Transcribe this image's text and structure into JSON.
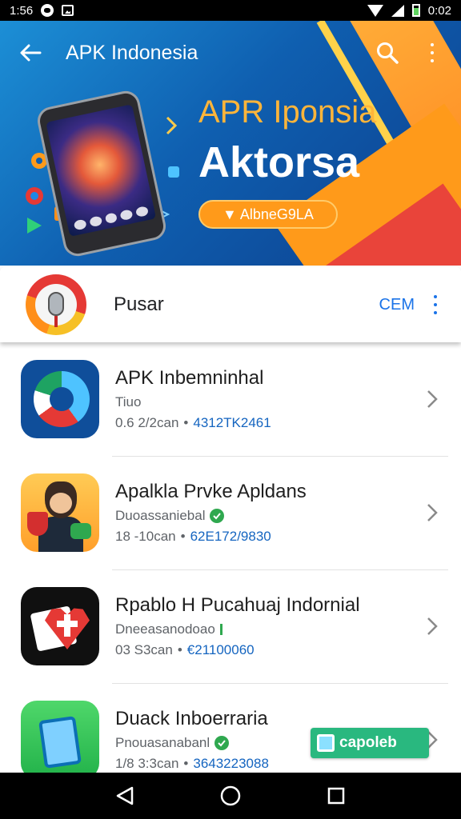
{
  "status_bar": {
    "time_left": "1:56",
    "time_right": "0:02"
  },
  "app_bar": {
    "title": "APK Indonesia"
  },
  "banner": {
    "headline": "APR Iponsia",
    "subheadline": "Aktorsa",
    "cta_label": "▼ AlbneG9LA"
  },
  "featured": {
    "title": "Pusar",
    "action_label": "CEM"
  },
  "apps": [
    {
      "title": "APK Inbemninhal",
      "developer": "Tiuo",
      "size": "0.6 2/2can",
      "code": "4312TK2461",
      "verified": false
    },
    {
      "title": "Apalkla Prvke Apldans",
      "developer": "Duoassaniebal",
      "size": "18 -10can",
      "code": "62E172/9830",
      "verified": true
    },
    {
      "title": "Rpablo H Pucahuaj Indornial",
      "developer": "Dneeasanodoao",
      "size": "03 S3can",
      "code": "€21100060",
      "verified": false
    },
    {
      "title": "Duack Inboerraria",
      "developer": "Pnouasanabanl",
      "size": "1/8 3:3can",
      "code": "3643223088",
      "verified": true
    }
  ],
  "toast": {
    "label": "capoleb"
  },
  "colors": {
    "accent": "#1a73e8",
    "banner_orange": "#ff9a1a",
    "verified": "#2fa84f"
  }
}
